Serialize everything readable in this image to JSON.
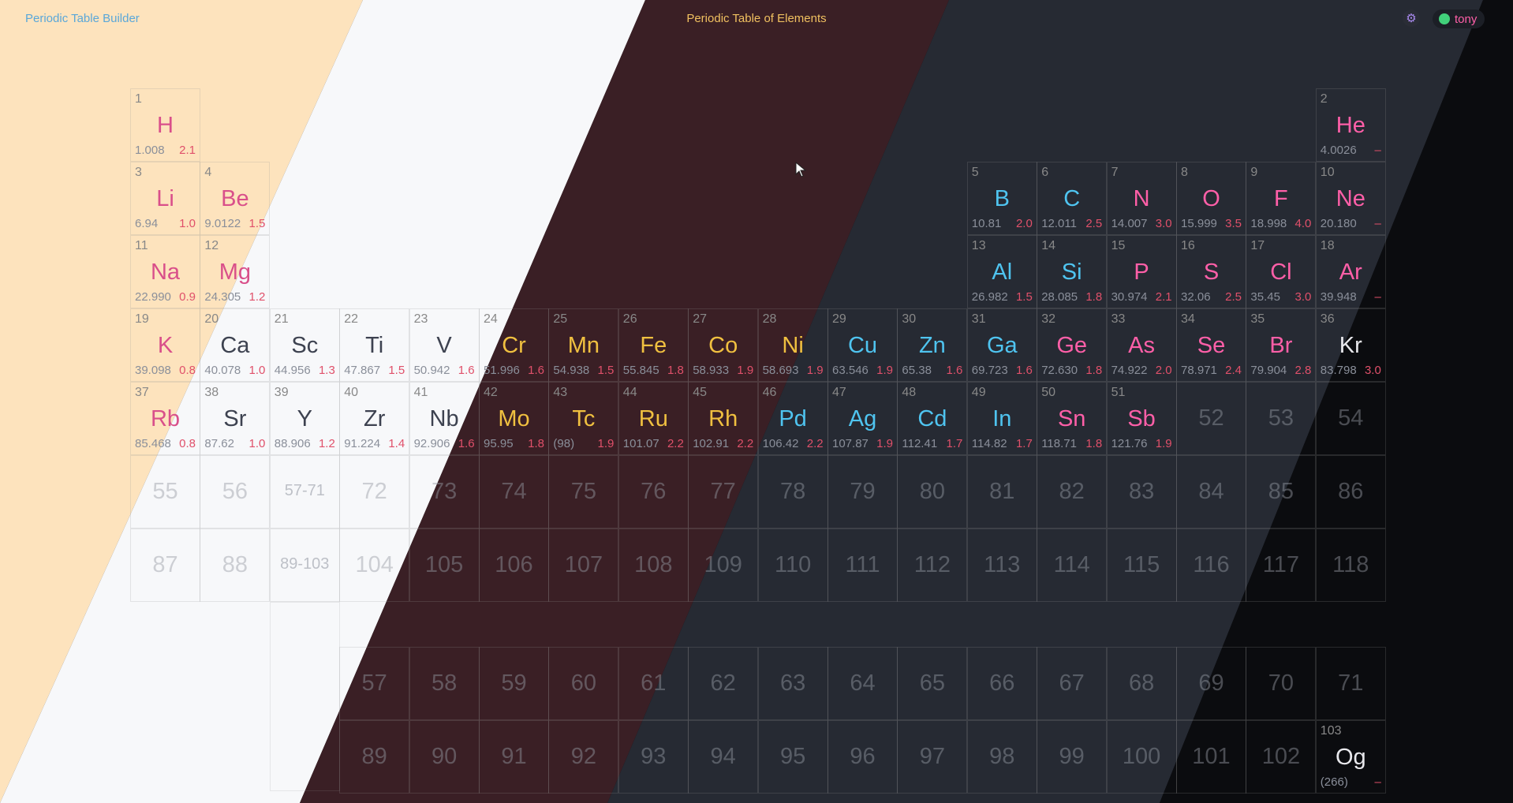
{
  "header": {
    "app_title": "Periodic Table Builder",
    "page_title": "Periodic Table of Elements",
    "settings_icon": "gear-icon",
    "user_name": "tony",
    "user_status_color": "#41d07a"
  },
  "colors": {
    "band_peach": "#fde3bd",
    "band_white": "#f7f8fa",
    "band_maroon": "#3a1f25",
    "band_slate": "#262a33",
    "band_black": "#0b0c0f",
    "accent_pink": "#ff5fa8",
    "accent_cyan": "#4fc4f0",
    "accent_gold": "#f0c040",
    "accent_purple": "#a98af0"
  },
  "elements": [
    {
      "num": "1",
      "sym": "H",
      "mass": "1.008",
      "en": "2.1",
      "col": 1,
      "row": 1,
      "color": "#d94f8a"
    },
    {
      "num": "2",
      "sym": "He",
      "mass": "4.0026",
      "en": "–",
      "col": 18,
      "row": 1,
      "color": "#ff5fa8"
    },
    {
      "num": "3",
      "sym": "Li",
      "mass": "6.94",
      "en": "1.0",
      "col": 1,
      "row": 2,
      "color": "#d94f8a"
    },
    {
      "num": "4",
      "sym": "Be",
      "mass": "9.0122",
      "en": "1.5",
      "col": 2,
      "row": 2,
      "color": "#d94f8a"
    },
    {
      "num": "5",
      "sym": "B",
      "mass": "10.81",
      "en": "2.0",
      "col": 13,
      "row": 2,
      "color": "#4fc4f0"
    },
    {
      "num": "6",
      "sym": "C",
      "mass": "12.011",
      "en": "2.5",
      "col": 14,
      "row": 2,
      "color": "#4fc4f0"
    },
    {
      "num": "7",
      "sym": "N",
      "mass": "14.007",
      "en": "3.0",
      "col": 15,
      "row": 2,
      "color": "#ff5fa8"
    },
    {
      "num": "8",
      "sym": "O",
      "mass": "15.999",
      "en": "3.5",
      "col": 16,
      "row": 2,
      "color": "#ff5fa8"
    },
    {
      "num": "9",
      "sym": "F",
      "mass": "18.998",
      "en": "4.0",
      "col": 17,
      "row": 2,
      "color": "#ff5fa8"
    },
    {
      "num": "10",
      "sym": "Ne",
      "mass": "20.180",
      "en": "–",
      "col": 18,
      "row": 2,
      "color": "#ff5fa8"
    },
    {
      "num": "11",
      "sym": "Na",
      "mass": "22.990",
      "en": "0.9",
      "col": 1,
      "row": 3,
      "color": "#d94f8a"
    },
    {
      "num": "12",
      "sym": "Mg",
      "mass": "24.305",
      "en": "1.2",
      "col": 2,
      "row": 3,
      "color": "#d94f8a"
    },
    {
      "num": "13",
      "sym": "Al",
      "mass": "26.982",
      "en": "1.5",
      "col": 13,
      "row": 3,
      "color": "#4fc4f0"
    },
    {
      "num": "14",
      "sym": "Si",
      "mass": "28.085",
      "en": "1.8",
      "col": 14,
      "row": 3,
      "color": "#4fc4f0"
    },
    {
      "num": "15",
      "sym": "P",
      "mass": "30.974",
      "en": "2.1",
      "col": 15,
      "row": 3,
      "color": "#ff5fa8"
    },
    {
      "num": "16",
      "sym": "S",
      "mass": "32.06",
      "en": "2.5",
      "col": 16,
      "row": 3,
      "color": "#ff5fa8"
    },
    {
      "num": "17",
      "sym": "Cl",
      "mass": "35.45",
      "en": "3.0",
      "col": 17,
      "row": 3,
      "color": "#ff5fa8"
    },
    {
      "num": "18",
      "sym": "Ar",
      "mass": "39.948",
      "en": "–",
      "col": 18,
      "row": 3,
      "color": "#ff5fa8"
    },
    {
      "num": "19",
      "sym": "K",
      "mass": "39.098",
      "en": "0.8",
      "col": 1,
      "row": 4,
      "color": "#d94f8a"
    },
    {
      "num": "20",
      "sym": "Ca",
      "mass": "40.078",
      "en": "1.0",
      "col": 2,
      "row": 4,
      "color": "#3d4250"
    },
    {
      "num": "21",
      "sym": "Sc",
      "mass": "44.956",
      "en": "1.3",
      "col": 3,
      "row": 4,
      "color": "#3d4250"
    },
    {
      "num": "22",
      "sym": "Ti",
      "mass": "47.867",
      "en": "1.5",
      "col": 4,
      "row": 4,
      "color": "#3d4250"
    },
    {
      "num": "23",
      "sym": "V",
      "mass": "50.942",
      "en": "1.6",
      "col": 5,
      "row": 4,
      "color": "#3d4250"
    },
    {
      "num": "24",
      "sym": "Cr",
      "mass": "51.996",
      "en": "1.6",
      "col": 6,
      "row": 4,
      "color": "#f0c040"
    },
    {
      "num": "25",
      "sym": "Mn",
      "mass": "54.938",
      "en": "1.5",
      "col": 7,
      "row": 4,
      "color": "#f0c040"
    },
    {
      "num": "26",
      "sym": "Fe",
      "mass": "55.845",
      "en": "1.8",
      "col": 8,
      "row": 4,
      "color": "#f0c040"
    },
    {
      "num": "27",
      "sym": "Co",
      "mass": "58.933",
      "en": "1.9",
      "col": 9,
      "row": 4,
      "color": "#f0c040"
    },
    {
      "num": "28",
      "sym": "Ni",
      "mass": "58.693",
      "en": "1.9",
      "col": 10,
      "row": 4,
      "color": "#f0c040"
    },
    {
      "num": "29",
      "sym": "Cu",
      "mass": "63.546",
      "en": "1.9",
      "col": 11,
      "row": 4,
      "color": "#4fc4f0"
    },
    {
      "num": "30",
      "sym": "Zn",
      "mass": "65.38",
      "en": "1.6",
      "col": 12,
      "row": 4,
      "color": "#4fc4f0"
    },
    {
      "num": "31",
      "sym": "Ga",
      "mass": "69.723",
      "en": "1.6",
      "col": 13,
      "row": 4,
      "color": "#4fc4f0"
    },
    {
      "num": "32",
      "sym": "Ge",
      "mass": "72.630",
      "en": "1.8",
      "col": 14,
      "row": 4,
      "color": "#ff5fa8"
    },
    {
      "num": "33",
      "sym": "As",
      "mass": "74.922",
      "en": "2.0",
      "col": 15,
      "row": 4,
      "color": "#ff5fa8"
    },
    {
      "num": "34",
      "sym": "Se",
      "mass": "78.971",
      "en": "2.4",
      "col": 16,
      "row": 4,
      "color": "#ff5fa8"
    },
    {
      "num": "35",
      "sym": "Br",
      "mass": "79.904",
      "en": "2.8",
      "col": 17,
      "row": 4,
      "color": "#ff5fa8"
    },
    {
      "num": "36",
      "sym": "Kr",
      "mass": "83.798",
      "en": "3.0",
      "col": 18,
      "row": 4,
      "color": "#e8e8ec"
    },
    {
      "num": "37",
      "sym": "Rb",
      "mass": "85.468",
      "en": "0.8",
      "col": 1,
      "row": 5,
      "color": "#d94f8a"
    },
    {
      "num": "38",
      "sym": "Sr",
      "mass": "87.62",
      "en": "1.0",
      "col": 2,
      "row": 5,
      "color": "#3d4250"
    },
    {
      "num": "39",
      "sym": "Y",
      "mass": "88.906",
      "en": "1.2",
      "col": 3,
      "row": 5,
      "color": "#3d4250"
    },
    {
      "num": "40",
      "sym": "Zr",
      "mass": "91.224",
      "en": "1.4",
      "col": 4,
      "row": 5,
      "color": "#3d4250"
    },
    {
      "num": "41",
      "sym": "Nb",
      "mass": "92.906",
      "en": "1.6",
      "col": 5,
      "row": 5,
      "color": "#3d4250"
    },
    {
      "num": "42",
      "sym": "Mo",
      "mass": "95.95",
      "en": "1.8",
      "col": 6,
      "row": 5,
      "color": "#f0c040"
    },
    {
      "num": "43",
      "sym": "Tc",
      "mass": "(98)",
      "en": "1.9",
      "col": 7,
      "row": 5,
      "color": "#f0c040"
    },
    {
      "num": "44",
      "sym": "Ru",
      "mass": "101.07",
      "en": "2.2",
      "col": 8,
      "row": 5,
      "color": "#f0c040"
    },
    {
      "num": "45",
      "sym": "Rh",
      "mass": "102.91",
      "en": "2.2",
      "col": 9,
      "row": 5,
      "color": "#f0c040"
    },
    {
      "num": "46",
      "sym": "Pd",
      "mass": "106.42",
      "en": "2.2",
      "col": 10,
      "row": 5,
      "color": "#4fc4f0"
    },
    {
      "num": "47",
      "sym": "Ag",
      "mass": "107.87",
      "en": "1.9",
      "col": 11,
      "row": 5,
      "color": "#4fc4f0"
    },
    {
      "num": "48",
      "sym": "Cd",
      "mass": "112.41",
      "en": "1.7",
      "col": 12,
      "row": 5,
      "color": "#4fc4f0"
    },
    {
      "num": "49",
      "sym": "In",
      "mass": "114.82",
      "en": "1.7",
      "col": 13,
      "row": 5,
      "color": "#4fc4f0"
    },
    {
      "num": "50",
      "sym": "Sn",
      "mass": "118.71",
      "en": "1.8",
      "col": 14,
      "row": 5,
      "color": "#ff5fa8"
    },
    {
      "num": "51",
      "sym": "Sb",
      "mass": "121.76",
      "en": "1.9",
      "col": 15,
      "row": 5,
      "color": "#ff5fa8"
    },
    {
      "num": "103",
      "sym": "Og",
      "mass": "(266)",
      "en": "–",
      "col": 18,
      "row": 10,
      "color": "#e8e8ec"
    }
  ],
  "placeholders": [
    {
      "label": "52",
      "col": 16,
      "row": 5
    },
    {
      "label": "53",
      "col": 17,
      "row": 5
    },
    {
      "label": "54",
      "col": 18,
      "row": 5
    },
    {
      "label": "55",
      "col": 1,
      "row": 6
    },
    {
      "label": "56",
      "col": 2,
      "row": 6
    },
    {
      "label": "72",
      "col": 4,
      "row": 6
    },
    {
      "label": "73",
      "col": 5,
      "row": 6
    },
    {
      "label": "74",
      "col": 6,
      "row": 6
    },
    {
      "label": "75",
      "col": 7,
      "row": 6
    },
    {
      "label": "76",
      "col": 8,
      "row": 6
    },
    {
      "label": "77",
      "col": 9,
      "row": 6
    },
    {
      "label": "78",
      "col": 10,
      "row": 6
    },
    {
      "label": "79",
      "col": 11,
      "row": 6
    },
    {
      "label": "80",
      "col": 12,
      "row": 6
    },
    {
      "label": "81",
      "col": 13,
      "row": 6
    },
    {
      "label": "82",
      "col": 14,
      "row": 6
    },
    {
      "label": "83",
      "col": 15,
      "row": 6
    },
    {
      "label": "84",
      "col": 16,
      "row": 6
    },
    {
      "label": "85",
      "col": 17,
      "row": 6
    },
    {
      "label": "86",
      "col": 18,
      "row": 6
    },
    {
      "label": "87",
      "col": 1,
      "row": 7
    },
    {
      "label": "88",
      "col": 2,
      "row": 7
    },
    {
      "label": "104",
      "col": 4,
      "row": 7
    },
    {
      "label": "105",
      "col": 5,
      "row": 7
    },
    {
      "label": "106",
      "col": 6,
      "row": 7
    },
    {
      "label": "107",
      "col": 7,
      "row": 7
    },
    {
      "label": "108",
      "col": 8,
      "row": 7
    },
    {
      "label": "109",
      "col": 9,
      "row": 7
    },
    {
      "label": "110",
      "col": 10,
      "row": 7
    },
    {
      "label": "111",
      "col": 11,
      "row": 7
    },
    {
      "label": "112",
      "col": 12,
      "row": 7
    },
    {
      "label": "113",
      "col": 13,
      "row": 7
    },
    {
      "label": "114",
      "col": 14,
      "row": 7
    },
    {
      "label": "115",
      "col": 15,
      "row": 7
    },
    {
      "label": "116",
      "col": 16,
      "row": 7
    },
    {
      "label": "117",
      "col": 17,
      "row": 7
    },
    {
      "label": "118",
      "col": 18,
      "row": 7
    },
    {
      "label": "57",
      "col": 4,
      "row": 9
    },
    {
      "label": "58",
      "col": 5,
      "row": 9
    },
    {
      "label": "59",
      "col": 6,
      "row": 9
    },
    {
      "label": "60",
      "col": 7,
      "row": 9
    },
    {
      "label": "61",
      "col": 8,
      "row": 9
    },
    {
      "label": "62",
      "col": 9,
      "row": 9
    },
    {
      "label": "63",
      "col": 10,
      "row": 9
    },
    {
      "label": "64",
      "col": 11,
      "row": 9
    },
    {
      "label": "65",
      "col": 12,
      "row": 9
    },
    {
      "label": "66",
      "col": 13,
      "row": 9
    },
    {
      "label": "67",
      "col": 14,
      "row": 9
    },
    {
      "label": "68",
      "col": 15,
      "row": 9
    },
    {
      "label": "69",
      "col": 16,
      "row": 9
    },
    {
      "label": "70",
      "col": 17,
      "row": 9
    },
    {
      "label": "71",
      "col": 18,
      "row": 9
    },
    {
      "label": "89",
      "col": 4,
      "row": 10
    },
    {
      "label": "90",
      "col": 5,
      "row": 10
    },
    {
      "label": "91",
      "col": 6,
      "row": 10
    },
    {
      "label": "92",
      "col": 7,
      "row": 10
    },
    {
      "label": "93",
      "col": 8,
      "row": 10
    },
    {
      "label": "94",
      "col": 9,
      "row": 10
    },
    {
      "label": "95",
      "col": 10,
      "row": 10
    },
    {
      "label": "96",
      "col": 11,
      "row": 10
    },
    {
      "label": "97",
      "col": 12,
      "row": 10
    },
    {
      "label": "98",
      "col": 13,
      "row": 10
    },
    {
      "label": "99",
      "col": 14,
      "row": 10
    },
    {
      "label": "100",
      "col": 15,
      "row": 10
    },
    {
      "label": "101",
      "col": 16,
      "row": 10
    },
    {
      "label": "102",
      "col": 17,
      "row": 10
    }
  ],
  "ranges": [
    {
      "label": "57-71",
      "col": 3,
      "row": 6
    },
    {
      "label": "89-103",
      "col": 3,
      "row": 7
    }
  ]
}
